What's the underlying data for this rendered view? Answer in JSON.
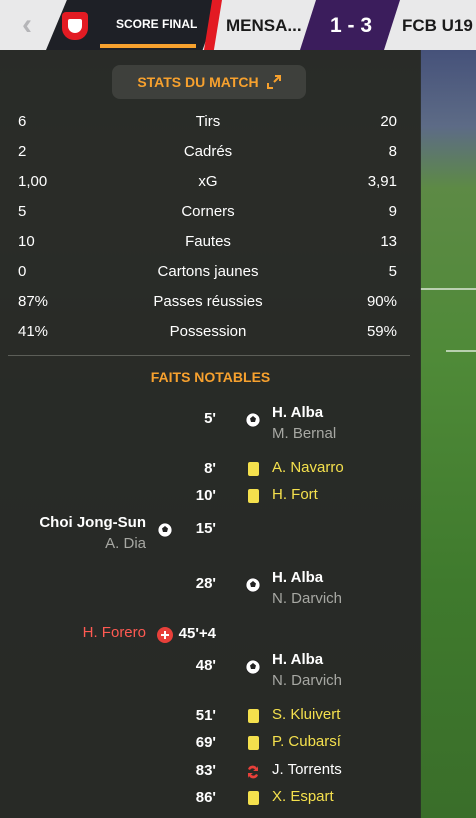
{
  "header": {
    "back_icon": "chevron-left-icon",
    "status": "SCORE FINAL",
    "home_team": "MENSA...",
    "score": "1 - 3",
    "away_team": "FCB U19"
  },
  "stats": {
    "title": "STATS DU MATCH",
    "rows": [
      {
        "label": "Tirs",
        "home": "6",
        "away": "20"
      },
      {
        "label": "Cadrés",
        "home": "2",
        "away": "8"
      },
      {
        "label": "xG",
        "home": "1,00",
        "away": "3,91"
      },
      {
        "label": "Corners",
        "home": "5",
        "away": "9"
      },
      {
        "label": "Fautes",
        "home": "10",
        "away": "13"
      },
      {
        "label": "Cartons jaunes",
        "home": "0",
        "away": "5"
      },
      {
        "label": "Passes réussies",
        "home": "87%",
        "away": "90%"
      },
      {
        "label": "Possession",
        "home": "41%",
        "away": "59%"
      }
    ]
  },
  "events": {
    "title": "FAITS NOTABLES",
    "items": [
      {
        "minute": "5'",
        "side": "away",
        "type": "goal",
        "player": "H. Alba",
        "assist": "M. Bernal"
      },
      {
        "minute": "8'",
        "side": "away",
        "type": "yellow",
        "player": "A. Navarro"
      },
      {
        "minute": "10'",
        "side": "away",
        "type": "yellow",
        "player": "H. Fort"
      },
      {
        "minute": "15'",
        "side": "home",
        "type": "goal",
        "player": "Choi Jong-Sun",
        "assist": "A. Dia"
      },
      {
        "minute": "28'",
        "side": "away",
        "type": "goal",
        "player": "H. Alba",
        "assist": "N. Darvich"
      },
      {
        "minute": "45'+4",
        "side": "home",
        "type": "injury",
        "player": "H. Forero"
      },
      {
        "minute": "48'",
        "side": "away",
        "type": "goal",
        "player": "H. Alba",
        "assist": "N. Darvich"
      },
      {
        "minute": "51'",
        "side": "away",
        "type": "yellow",
        "player": "S. Kluivert"
      },
      {
        "minute": "69'",
        "side": "away",
        "type": "yellow",
        "player": "P. Cubarsí"
      },
      {
        "minute": "83'",
        "side": "away",
        "type": "injury-sub",
        "player": "J. Torrents"
      },
      {
        "minute": "86'",
        "side": "away",
        "type": "yellow",
        "player": "X. Espart"
      }
    ]
  },
  "colors": {
    "accent": "#f7a12e",
    "yellow_card": "#f4e04d",
    "red_text": "#ff5a52",
    "score_box": "#3b1d5c",
    "club_red": "#e31b23"
  }
}
